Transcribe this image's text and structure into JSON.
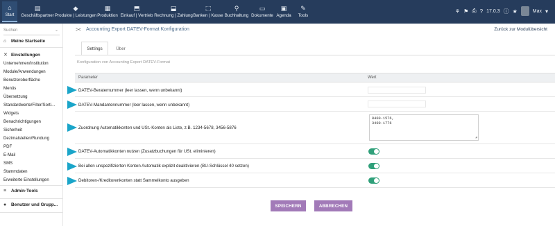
{
  "topbar": {
    "menu": [
      {
        "icon": "⌂",
        "label": "Start",
        "active": true
      },
      {
        "icon": "▤",
        "label": "Geschäftspartner"
      },
      {
        "icon": "◆",
        "label": "Produkte | Leistungen"
      },
      {
        "icon": "▦",
        "label": "Produktion"
      },
      {
        "icon": "⬒",
        "label": "Einkauf | Vertrieb"
      },
      {
        "icon": "⬓",
        "label": "Rechnung | Zahlung"
      },
      {
        "icon": "⬚",
        "label": "Banken | Kasse"
      },
      {
        "icon": "⚲",
        "label": "Buchhaltung"
      },
      {
        "icon": "▭",
        "label": "Dokumente"
      },
      {
        "icon": "▣",
        "label": "Agenda"
      },
      {
        "icon": "✎",
        "label": "Tools"
      }
    ],
    "version": "17.0.3",
    "user": "Max"
  },
  "sidebar": {
    "search_placeholder": "Suchen",
    "home": "Meine Startseite",
    "settings_section": "Einstellungen",
    "settings_items": [
      "Unternehmen/Institution",
      "Module/Anwendungen",
      "Benutzeroberfläche",
      "Menüs",
      "Übersetzung",
      "Standardwerte/Filter/Sorti...",
      "Widgets",
      "Benachrichtigungen",
      "Sicherheit",
      "Dezimalstellen/Rundung",
      "PDF",
      "E-Mail",
      "SMS",
      "Stammdaten",
      "Erweiterte Einstellungen"
    ],
    "admin_tools": "Admin-Tools",
    "users_groups": "Benutzer und Grupp..."
  },
  "main": {
    "title": "Accounting Export DATEV-Format Konfiguration",
    "back_link": "Zurück zur Modulübersicht",
    "tabs": [
      "Settings",
      "Über"
    ],
    "description": "Konfiguration von Accounting Export DATEV-Format",
    "table": {
      "col_param": "Parameter",
      "col_value": "Wert",
      "rows": [
        {
          "label": "DATEV-Beraternummer (leer lassen, wenn unbekannt)",
          "value": ""
        },
        {
          "label": "DATEV-Mandantennummer (leer lassen, wenn unbekannt)",
          "value": ""
        },
        {
          "label": "Zuordnung Automatikkonten und USt.-Konten als Liste, z.B. 1234-5678, 3456-5876",
          "value": "8400-1576,\n3400-1776"
        },
        {
          "label": "DATEV-Automatikkonten nutzen (Zusatzbuchungen für USt. eliminieren)",
          "toggle": true
        },
        {
          "label": "Bei allen unspezifizierten Konten Automatik explizit deaktivieren (BU-Schlüssel 40 setzen)",
          "toggle": true
        },
        {
          "label": "Debitoren-/Kreditorenkonten statt Sammelkonto ausgeben",
          "toggle": true
        }
      ]
    },
    "save_button": "SPEICHERN",
    "cancel_button": "ABBRECHEN"
  },
  "colors": {
    "topbar": "#263c5c",
    "accent_arrow": "#1aa5c9",
    "toggle_on": "#30a07a",
    "button": "#a27ab8"
  }
}
